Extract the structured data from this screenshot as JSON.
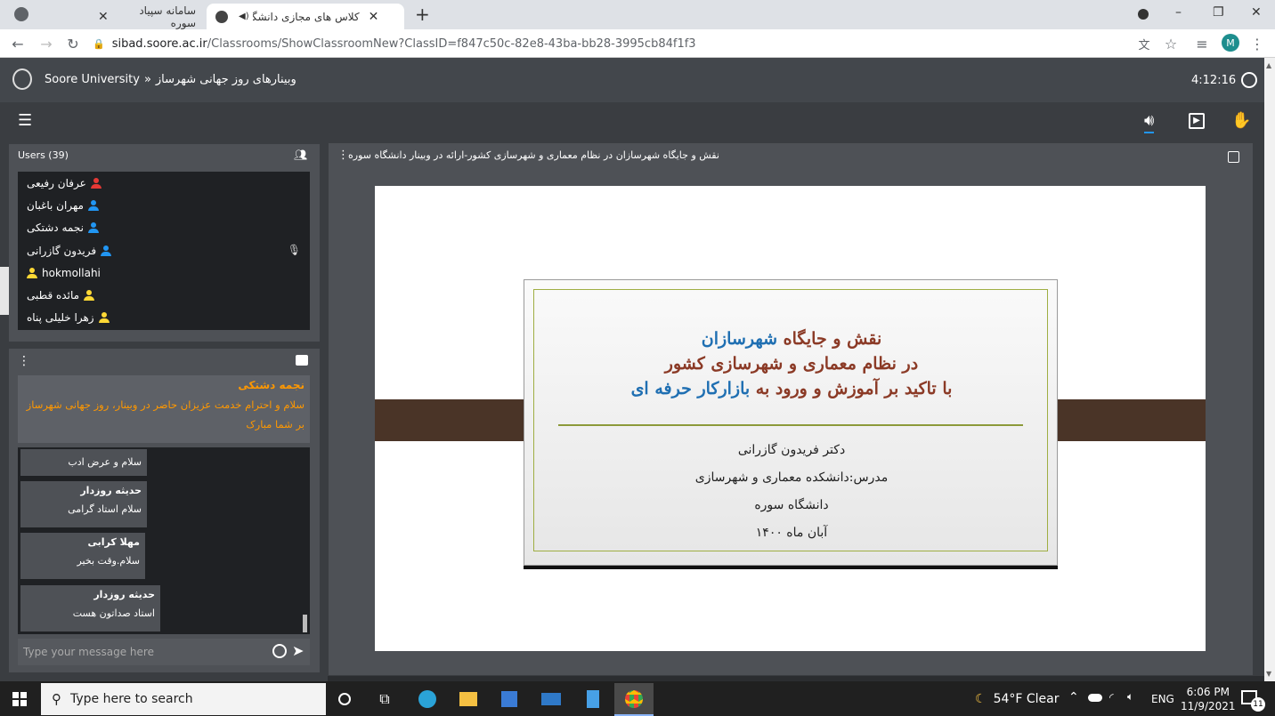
{
  "browser": {
    "tabs": [
      {
        "title": "سامانه سپیاد سوره",
        "close": "✕"
      },
      {
        "title": "کلاس های مجازی دانشگاه سور",
        "close": "✕"
      }
    ],
    "new_tab": "+",
    "url_host": "sibad.soore.ac.ir",
    "url_path": "/Classrooms/ShowClassroomNew?ClassID=f847c50c-82e8-43ba-bb28-3995cb84f1f3",
    "profile_initial": "M",
    "window_controls": [
      "–",
      "❐",
      "✕"
    ]
  },
  "header": {
    "breadcrumb_site": "Soore University",
    "breadcrumb_sep": "»",
    "class_title": "وبینارهای روز جهانی شهرساز",
    "timer": "4:12:16"
  },
  "users": {
    "title": "Users (39)",
    "list": [
      {
        "name": "عرفان رفیعی",
        "color": "#e53935"
      },
      {
        "name": "مهران باغبان",
        "color": "#2196f3"
      },
      {
        "name": "نجمه دشتکی",
        "color": "#2196f3"
      },
      {
        "name": "فریدون گازرانی",
        "color": "#2196f3"
      },
      {
        "name": "hokmollahi",
        "color": "#fdd835"
      },
      {
        "name": "مائده قطبی",
        "color": "#fdd835"
      },
      {
        "name": "زهرا خلیلی پناه",
        "color": "#fdd835"
      }
    ]
  },
  "chat": {
    "pinned_author": "نجمه دشتکی",
    "pinned_text": "سلام و احترام خدمت عزیزان حاضر در وبینار، روز جهانی شهرساز بر شما مبارک",
    "messages": [
      {
        "author": "",
        "text": "سلام و عرض ادب"
      },
      {
        "author": "حدیثه روزدار",
        "text": "سلام استاد گرامی"
      },
      {
        "author": "مهلا کرابی",
        "text": "سلام.وقت بخیر"
      },
      {
        "author": "حدیثه روزدار",
        "text": "استاد صداتون هست"
      }
    ],
    "input_placeholder": "Type your message here"
  },
  "presentation": {
    "title": "نقش و جایگاه شهرسازان در نظام معماری و شهرسازی کشور-ارائه در وبینار دانشگاه سوره",
    "slide": {
      "line1_a": "نقش و جایگاه ",
      "line1_b": "شهرسازان",
      "line2": "در نظام معماری و شهرسازی کشور",
      "line3_a": "با تاکید بر آموزش و ورود به ",
      "line3_b": "بازارکار حرفه ای",
      "author": "دکتر فریدون گازرانی",
      "role": "مدرس:دانشکده معماری و شهرسازی",
      "university": "دانشگاه سوره",
      "date": "آبان ماه ۱۴۰۰"
    }
  },
  "taskbar": {
    "search_placeholder": "Type here to search",
    "weather": "54°F  Clear",
    "lang": "ENG",
    "time": "6:06 PM",
    "date": "11/9/2021",
    "notif_count": "11"
  }
}
